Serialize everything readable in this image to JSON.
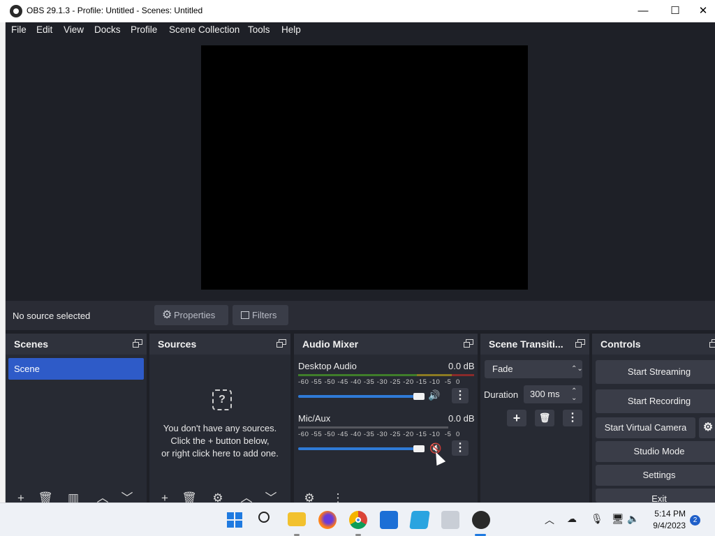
{
  "window": {
    "title": "OBS 29.1.3 - Profile: Untitled - Scenes: Untitled",
    "minimize": "—",
    "maximize": "☐",
    "close": "✕"
  },
  "menu": [
    "File",
    "Edit",
    "View",
    "Docks",
    "Profile",
    "Scene Collection",
    "Tools",
    "Help"
  ],
  "context": {
    "no_source": "No source selected",
    "properties": "Properties",
    "filters": "Filters"
  },
  "docks": {
    "scenes": {
      "title": "Scenes",
      "items": [
        "Scene"
      ]
    },
    "sources": {
      "title": "Sources",
      "empty_line1": "You don't have any sources.",
      "empty_line2": "Click the + button below,",
      "empty_line3": "or right click here to add one."
    },
    "mixer": {
      "title": "Audio Mixer",
      "channels": [
        {
          "name": "Desktop Audio",
          "db": "0.0 dB",
          "volume": 1.0,
          "muted": false
        },
        {
          "name": "Mic/Aux",
          "db": "0.0 dB",
          "volume": 1.0,
          "muted": true
        }
      ],
      "scale": [
        "-60",
        "-55",
        "-50",
        "-45",
        "-40",
        "-35",
        "-30",
        "-25",
        "-20",
        "-15",
        "-10",
        "-5",
        "0"
      ]
    },
    "transitions": {
      "title": "Scene Transiti...",
      "selected": "Fade",
      "duration_label": "Duration",
      "duration_value": "300 ms"
    },
    "controls": {
      "title": "Controls",
      "buttons": [
        "Start Streaming",
        "Start Recording",
        "Start Virtual Camera",
        "Studio Mode",
        "Settings",
        "Exit"
      ]
    }
  },
  "taskbar": {
    "time": "5:14 PM",
    "date": "9/4/2023",
    "notification_count": "2",
    "icons": [
      "windows-start-icon",
      "search-icon",
      "file-explorer-icon",
      "firefox-icon",
      "chrome-icon",
      "microsoft-store-icon",
      "app-icon",
      "app-icon-2",
      "obs-icon"
    ]
  },
  "colors": {
    "accent": "#2e5bc8",
    "panel": "#272a33",
    "background": "#1e2027",
    "button": "#3a3d48",
    "muted_icon": "#d12b2b"
  }
}
